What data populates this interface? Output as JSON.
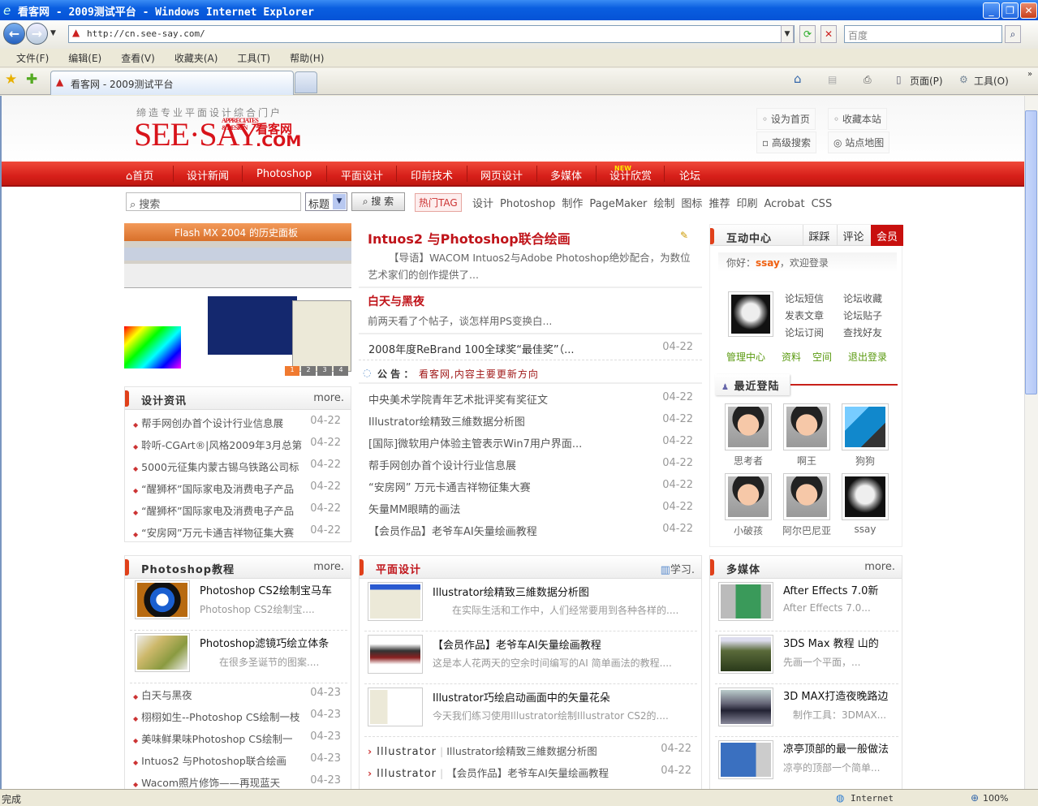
{
  "window": {
    "title": "看客网 - 2009测试平台 - Windows Internet Explorer",
    "min": "_",
    "max": "❐",
    "close": "✕"
  },
  "browser": {
    "url": "http://cn.see-say.com/",
    "search_placeholder": "百度",
    "menu": [
      "文件(F)",
      "编辑(E)",
      "查看(V)",
      "收藏夹(A)",
      "工具(T)",
      "帮助(H)"
    ],
    "tab_title": "看客网 - 2009测试平台",
    "page_menu": "页面(P)",
    "tools_menu": "工具(O)",
    "status": "完成",
    "zone": "Internet",
    "zoom": "100%"
  },
  "header": {
    "tagline": "缔造专业平面设计综合门户",
    "logo": "SEE·SAY",
    "logo_sub": "APPRECIATES & DESIGN",
    "logo_cn": "看客网",
    "logo_com": ".COM",
    "links": [
      "设为首页",
      "收藏本站",
      "高级搜索",
      "站点地图"
    ]
  },
  "nav": {
    "items": [
      "首页",
      "设计新闻",
      "Photoshop",
      "平面设计",
      "印前技术",
      "网页设计",
      "多媒体",
      "设计欣赏",
      "论坛"
    ],
    "new_badge": "NEW"
  },
  "search": {
    "placeholder": "搜索",
    "select": "标题",
    "button": "搜 索",
    "hot_label": "热门TAG",
    "tags": [
      "设计",
      "Photoshop",
      "制作",
      "PageMaker",
      "绘制",
      "图标",
      "推荐",
      "印刷",
      "Acrobat",
      "CSS"
    ]
  },
  "slideshow": {
    "caption": "Flash MX 2004 的历史面板",
    "pages": [
      "1",
      "2",
      "3",
      "4"
    ]
  },
  "headline": {
    "title": "Intuos2 与Photoshop联合绘画",
    "summary": "【导语】WACOM Intuos2与Adobe Photoshop绝妙配合，为数位艺术家们的创作提供了...",
    "second_title": "白天与黑夜",
    "second_summary": "前两天看了个帖子，谈怎样用PS变换白...",
    "row": {
      "title": "2008年度ReBrand 100全球奖“最佳奖”（...",
      "date": "04-22"
    },
    "notice_label": "公 告 ：",
    "notice": "看客网,内容主要更新方向"
  },
  "news_list": [
    {
      "title": "中央美术学院青年艺术批评奖有奖征文",
      "date": "04-22"
    },
    {
      "title": "Illustrator绘精致三維数据分析图",
      "date": "04-22"
    },
    {
      "title": "[国际]微软用户体验主管表示Win7用户界面...",
      "date": "04-22"
    },
    {
      "title": "帮手网创办首个设计行业信息展",
      "date": "04-22"
    },
    {
      "title": "“安房网” 万元卡通吉祥物征集大赛",
      "date": "04-22"
    },
    {
      "title": "矢量MM眼睛的画法",
      "date": "04-22"
    },
    {
      "title": "【会员作品】老爷车AI矢量绘画教程",
      "date": "04-22"
    }
  ],
  "design_news": {
    "title": "设计资讯",
    "more": "more.",
    "items": [
      {
        "title": "帮手网创办首个设计行业信息展",
        "date": "04-22"
      },
      {
        "title": "聆听-CGArt®|风格2009年3月总第",
        "date": "04-22"
      },
      {
        "title": "5000元征集内蒙古锡乌铁路公司标",
        "date": "04-22"
      },
      {
        "title": "“醒狮杯”国际家电及消费电子产品",
        "date": "04-22"
      },
      {
        "title": "“醒狮杯”国际家电及消费电子产品",
        "date": "04-22"
      },
      {
        "title": "“安房网”万元卡通吉祥物征集大赛",
        "date": "04-22"
      }
    ]
  },
  "member": {
    "title": "互动中心",
    "tabs": [
      "踩踩",
      "评论",
      "会员"
    ],
    "greeting": "你好：",
    "username": "ssay",
    "welcome": "，欢迎登录",
    "links": [
      "论坛短信",
      "论坛收藏",
      "发表文章",
      "论坛贴子",
      "论坛订阅",
      "查找好友"
    ],
    "actions": [
      "管理中心",
      "资料",
      "空间",
      "退出登录"
    ],
    "recent_title": "最近登陆",
    "recent": [
      "思考者",
      "啊王",
      "狗狗",
      "小破孩",
      "阿尔巴尼亚",
      "ssay"
    ]
  },
  "ps_tutorials": {
    "title": "Photoshop教程",
    "more": "more.",
    "featured": [
      {
        "title": "Photoshop CS2绘制宝马车",
        "summary": "Photoshop CS2绘制宝...."
      },
      {
        "title": "Photoshop滤镜巧绘立体条",
        "summary": "在很多圣诞节的图案...."
      }
    ],
    "items": [
      {
        "title": "白天与黑夜",
        "date": "04-23"
      },
      {
        "title": "栩栩如生--Photoshop CS绘制一枝",
        "date": "04-23"
      },
      {
        "title": "美味鲜果味Photoshop CS绘制一",
        "date": "04-23"
      },
      {
        "title": "Intuos2 与Photoshop联合绘画",
        "date": "04-23"
      },
      {
        "title": "Wacom照片修饰——再现蓝天",
        "date": "04-23"
      }
    ]
  },
  "graphic_design": {
    "title": "平面设计",
    "more": "学习.",
    "featured": [
      {
        "title": "Illustrator绘精致三維数据分析图",
        "summary": "在实际生活和工作中，人们经常要用到各种各样的...."
      },
      {
        "title": "【会员作品】老爷车AI矢量绘画教程",
        "summary": "这是本人花两天的空余时间编写的AI 简单画法的教程...."
      },
      {
        "title": "Illustrator巧绘启动画面中的矢量花朵",
        "summary": "今天我们练习使用Illustrator绘制Illustrator CS2的...."
      }
    ],
    "items": [
      {
        "category": "Illustrator",
        "title": "Illustrator绘精致三維数据分析图",
        "date": "04-22"
      },
      {
        "category": "Illustrator",
        "title": "【会员作品】老爷车AI矢量绘画教程",
        "date": "04-22"
      }
    ]
  },
  "multimedia": {
    "title": "多媒体",
    "more": "more.",
    "featured": [
      {
        "title": "After Effects 7.0新",
        "summary": "After Effects 7.0..."
      },
      {
        "title": "3DS Max 教程  山的",
        "summary": "先画一个平面，..."
      },
      {
        "title": "3D MAX打造夜晚路边",
        "summary": "制作工具：3DMAX..."
      },
      {
        "title": "凉亭顶部的最一般做法",
        "summary": "凉亭的顶部一个简单..."
      }
    ]
  },
  "colors": {
    "brand_red": "#d8201a",
    "link_green": "#5a9a10",
    "title_red": "#c0141a"
  }
}
